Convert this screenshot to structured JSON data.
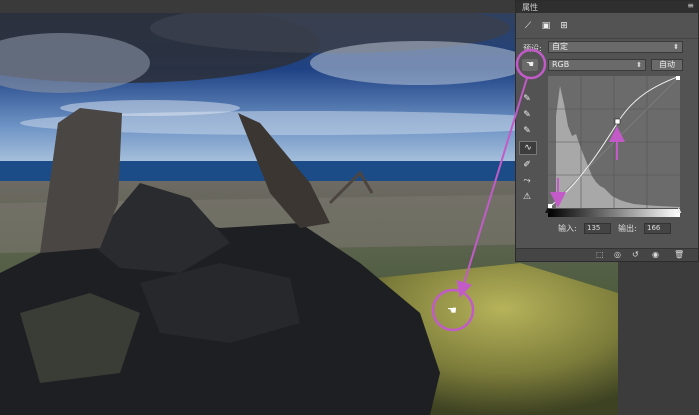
{
  "panel": {
    "title": "属性",
    "menu_icon": "menu-icon",
    "preset_label": "预设:",
    "preset_value": "自定",
    "channel_value": "RGB",
    "auto_button": "自动",
    "input_label": "输入:",
    "input_value": "135",
    "output_label": "输出:",
    "output_value": "166"
  },
  "tools": [
    "eyedropper-icon",
    "eyedropper-icon",
    "eyedropper-icon",
    "curve-tool-icon",
    "pencil-icon",
    "smooth-icon",
    "histogram-warning-icon"
  ],
  "footer_icons": [
    "clip-to-layer-icon",
    "visibility-icon",
    "reset-icon",
    "eye-icon",
    "delete-icon"
  ],
  "colors": {
    "highlight_circle": "#c25bc8",
    "panel_bg": "#535353",
    "sky_top": "#1e3c7a",
    "ocean": "#1f4f8c"
  }
}
